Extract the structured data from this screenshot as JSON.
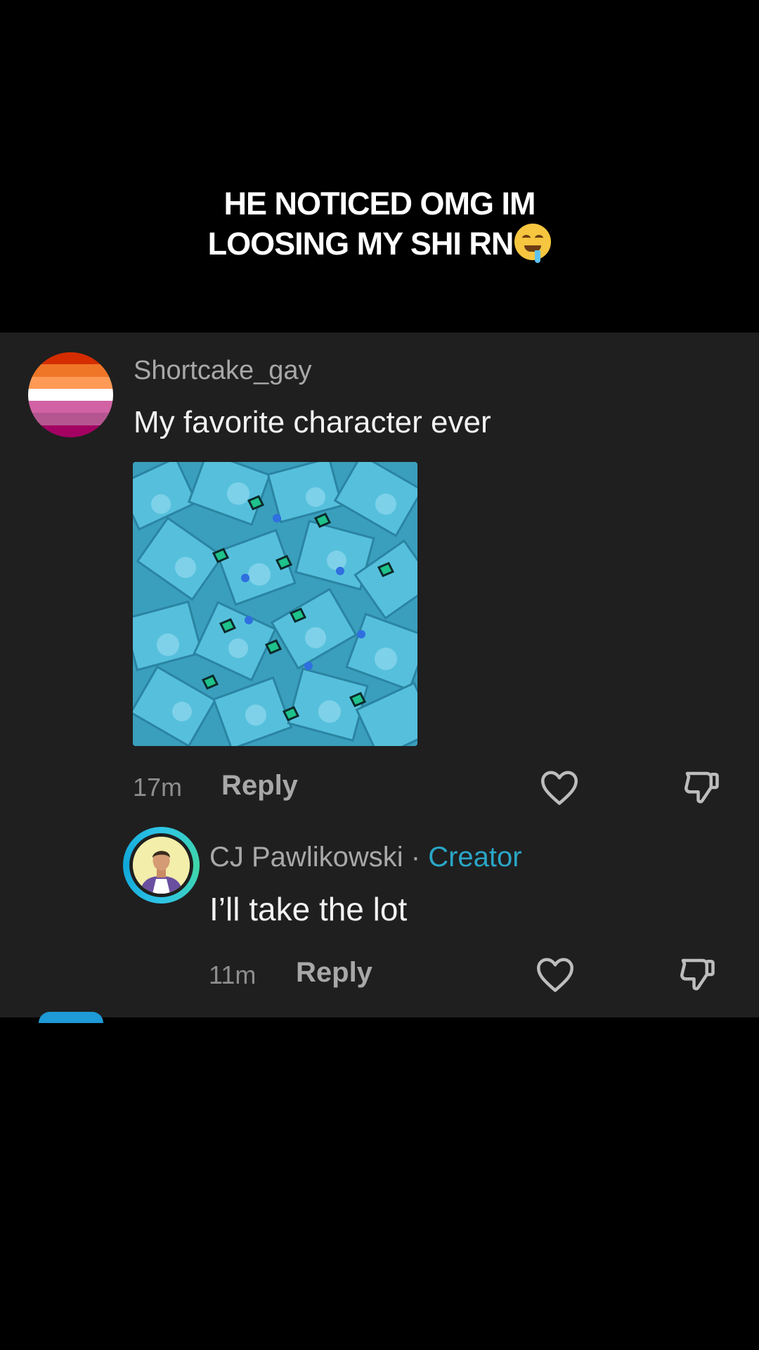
{
  "overlay_caption": {
    "line1": "HE NOTICED OMG IM",
    "line2": "LOOSING MY SHI RN",
    "emoji": "drooling-face-emoji"
  },
  "colors": {
    "background": "#000000",
    "panel": "#1f1f1f",
    "creator_accent": "#2aa6c8",
    "lesbian_flag": [
      "#d52d00",
      "#ef7627",
      "#ff9a56",
      "#ffffff",
      "#d162a4",
      "#b55690",
      "#a30262"
    ]
  },
  "comment": {
    "username": "Shortcake_gay",
    "text": "My favorite character ever",
    "image_description_icon": "blue-candies-image",
    "time": "17m",
    "reply_label": "Reply"
  },
  "reply": {
    "username": "CJ Pawlikowski",
    "separator": "·",
    "badge": "Creator",
    "text": "I’ll take the lot",
    "time": "11m",
    "reply_label": "Reply"
  }
}
